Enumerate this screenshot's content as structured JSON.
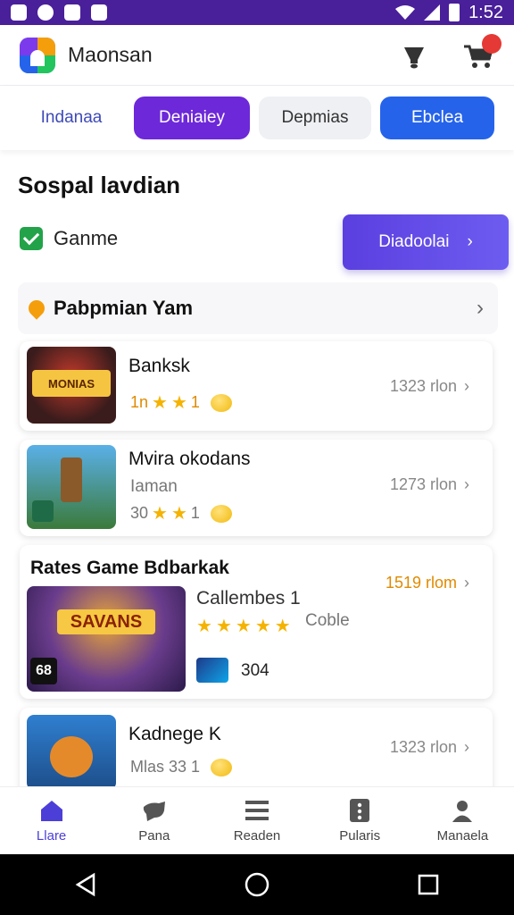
{
  "status_bar": {
    "time": "1:52"
  },
  "app_bar": {
    "title": "Maonsan",
    "cart_badge": ""
  },
  "filters": [
    {
      "label": "Indanaa"
    },
    {
      "label": "Deniaiey"
    },
    {
      "label": "Depmias"
    },
    {
      "label": "Ebclea"
    }
  ],
  "section": {
    "title": "Sospal lavdian",
    "checkbox_label": "Ganme",
    "cta_label": "Diadoolai"
  },
  "promo": {
    "title": "Pabpmian Yam"
  },
  "games": [
    {
      "name": "Banksk",
      "rating_text": "1n",
      "meta": "1323 rlon"
    },
    {
      "name": "Mvira okodans",
      "subtitle": "Iaman",
      "rating_text": "30",
      "meta": "1273 rlon"
    },
    {
      "header": "Rates Game Bdbarkak",
      "name": "Callembes 1",
      "extra": "Coble",
      "small_label": "304",
      "meta": "1519 rlom",
      "thumb_label": "SAVANS",
      "thumb_badge": "68"
    },
    {
      "name": "Kadnege K",
      "rating_text": "Mlas 33 1",
      "meta": "1323 rlon"
    }
  ],
  "thumb_labels": {
    "game1": "MONIAS"
  },
  "bottom_nav": [
    {
      "label": "Llare"
    },
    {
      "label": "Pana"
    },
    {
      "label": "Readen"
    },
    {
      "label": "Pularis"
    },
    {
      "label": "Manaela"
    }
  ],
  "colors": {
    "primary_purple": "#6d28d9",
    "primary_blue": "#2563eb",
    "status_bar": "#4a1f9a"
  }
}
